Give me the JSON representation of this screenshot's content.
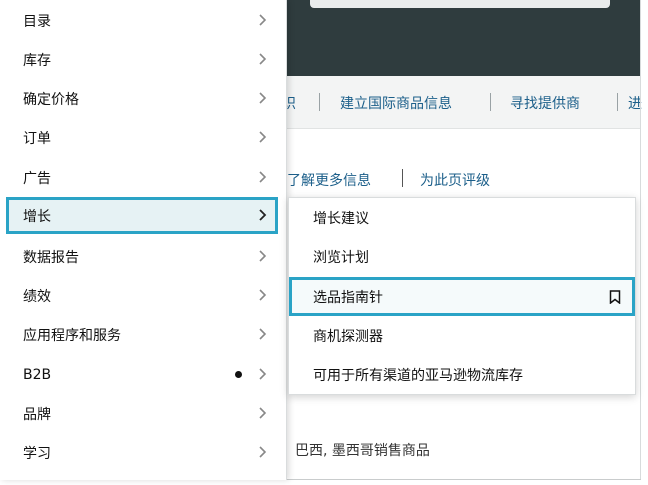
{
  "background": {
    "nav_links": [
      "识",
      "建立国际商品信息",
      "寻找提供商",
      "进"
    ],
    "help_links": [
      "了解更多信息",
      "为此页评级"
    ],
    "snippet": "巴西, 墨西哥销售商品"
  },
  "main_menu": {
    "items": [
      {
        "label": "目录"
      },
      {
        "label": "库存"
      },
      {
        "label": "确定价格"
      },
      {
        "label": "订单"
      },
      {
        "label": "广告"
      },
      {
        "label": "增长"
      },
      {
        "label": "数据报告"
      },
      {
        "label": "绩效"
      },
      {
        "label": "应用程序和服务"
      },
      {
        "label": "B2B"
      },
      {
        "label": "品牌"
      },
      {
        "label": "学习"
      }
    ],
    "active_index": 5,
    "dot_item": "B2B"
  },
  "submenu": {
    "items": [
      {
        "label": "增长建议"
      },
      {
        "label": "浏览计划"
      },
      {
        "label": "选品指南针"
      },
      {
        "label": "商机探测器"
      },
      {
        "label": "可用于所有渠道的亚马逊物流库存"
      }
    ],
    "active_index": 2
  },
  "colors": {
    "accent": "#2aa3c6",
    "topbar": "#2f3c3e",
    "link": "#1c5f8a"
  },
  "icons": {
    "chevron": "chevron-right-icon",
    "bookmark": "bookmark-icon",
    "dot": "notification-dot-icon"
  }
}
